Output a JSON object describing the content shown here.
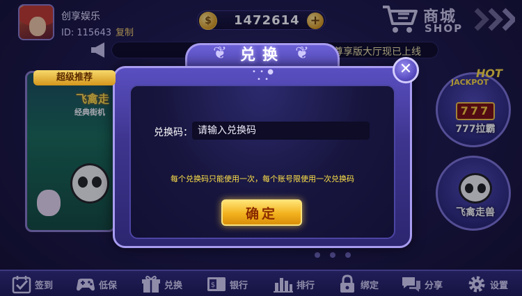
{
  "user": {
    "name": "创享娱乐",
    "id_text": "ID: 115643",
    "copy_label": "复制"
  },
  "coins": {
    "amount": "1472614",
    "coin_symbol": "$",
    "plus_symbol": "+"
  },
  "shop": {
    "label_zh": "商城",
    "label_en": "SHOP"
  },
  "marquee": {
    "text": "新尊享版大厅现已上线"
  },
  "promo": {
    "badge": "超级推荐",
    "game_name": "飞禽走",
    "subtitle": "经典街机"
  },
  "games": [
    {
      "badge": "HOT",
      "brand": "JACKPOT",
      "reels": "777",
      "label": "777拉霸"
    },
    {
      "label": "飞禽走兽"
    }
  ],
  "dialog": {
    "title": "兑换",
    "field_label": "兑换码：",
    "input_placeholder": "请输入兑换码",
    "input_value": "",
    "hint": "每个兑换码只能使用一次，每个账号限使用一次兑换码",
    "confirm_label": "确定",
    "close_symbol": "✕"
  },
  "bottom_nav": [
    {
      "label": "签到",
      "icon": "calendar-check-icon"
    },
    {
      "label": "低保",
      "icon": "gamepad-icon"
    },
    {
      "label": "兑换",
      "icon": "gift-icon"
    },
    {
      "label": "银行",
      "icon": "bank-card-icon"
    },
    {
      "label": "排行",
      "icon": "ranking-bars-icon"
    },
    {
      "label": "绑定",
      "icon": "lock-icon"
    },
    {
      "label": "分享",
      "icon": "chat-bubbles-icon"
    },
    {
      "label": "设置",
      "icon": "gear-icon"
    }
  ],
  "colors": {
    "accent_gold": "#f2b11d",
    "hint_yellow": "#ffe24a",
    "dialog_purple": "#3e358f"
  }
}
